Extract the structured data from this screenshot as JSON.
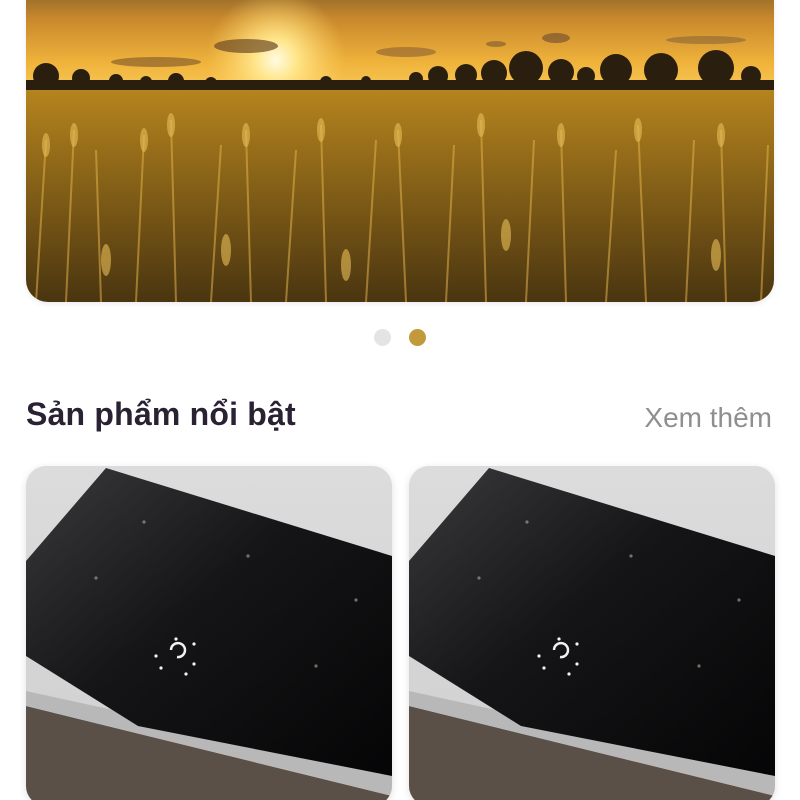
{
  "banner": {
    "image": "wheat-field-sunset-image",
    "slide_count": 2,
    "active_slide": 2
  },
  "featured": {
    "title": "Sản phẩm nổi bật",
    "see_more_label": "Xem thêm",
    "products": [
      {
        "image": "induction-cooktop-image"
      },
      {
        "image": "induction-cooktop-image"
      }
    ]
  },
  "colors": {
    "accent": "#c29a3a",
    "dot_inactive": "#e4e4e6",
    "title": "#2a2233",
    "muted": "#8f8f8f"
  }
}
